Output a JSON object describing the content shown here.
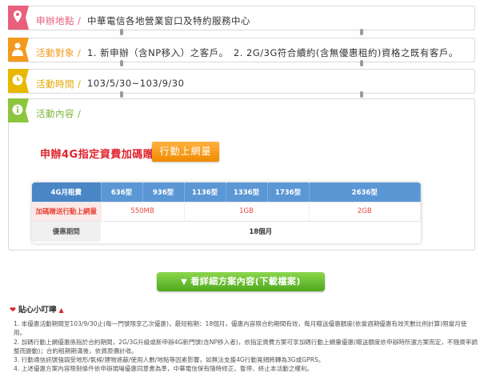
{
  "location": {
    "label": "申辦地點",
    "sep": "/",
    "value": "中華電信各地營業窗口及特約服務中心"
  },
  "target": {
    "label": "活動對象",
    "sep": "/",
    "value": "1. 新申辦（含NP移入）之客戶。　2. 2G/3G符合續約(含無優惠租約)資格之既有客戶。"
  },
  "period": {
    "label": "活動時間",
    "sep": "/",
    "value": "103/5/30~103/9/30"
  },
  "content": {
    "label": "活動內容",
    "sep": "/",
    "promo_title": "申辦4G指定資費加碼贈送",
    "promo_button": "行動上網量"
  },
  "plans": {
    "header_label": "4G月租費",
    "plans": [
      "636型",
      "936型",
      "1136型",
      "1336型",
      "1736型",
      "2636型"
    ],
    "bonus_label": "加碼贈送行動上網量",
    "bonus_values": [
      "550MB",
      "1GB",
      "2GB"
    ],
    "period_label": "優惠期間",
    "period_value": "18個月"
  },
  "download_button": "看詳細方案內容(下載檔案)",
  "tips": {
    "title": "貼心小叮嚀",
    "items": [
      "1. 本優惠活動期間至103/9/30止(每一門號限享乙次優惠)，最短租期：18個月，優惠內容限合約期間有效，每月贈送優惠額度(依當週期優惠有效天數比例計算)限當月使用。",
      "2. 加碼行動上網優惠係指於合約期間，2G/3G升級或新申辦4G新門號(含NP移入者)，依指定資費方案可享加碼行動上網量優惠(贈送額度依申辦時所選方案而定，不隨資率調整而變動)；合約租期期滿後，依資原價計收。",
      "3. 行動通信訊號強弱受地形/氣候/建物遮蔽/使用人數/地點等因素影響，如無法支援4G行動寬頻將轉為3G或GPRS。",
      "4. 上述優惠方案內容限制條件依申辦現場優惠同意書為準，中華電信保有隨時修正、暫停、終止本活動之權利。"
    ]
  },
  "colors": {
    "pink": "#e8607c",
    "orange": "#f39a1e",
    "yellow": "#e8b800",
    "green": "#8cc63f",
    "table_blue": "#5b97d4"
  },
  "icons": {
    "location": "pin-icon",
    "target": "person-icon",
    "period": "clock-icon",
    "content": "info-icon"
  }
}
